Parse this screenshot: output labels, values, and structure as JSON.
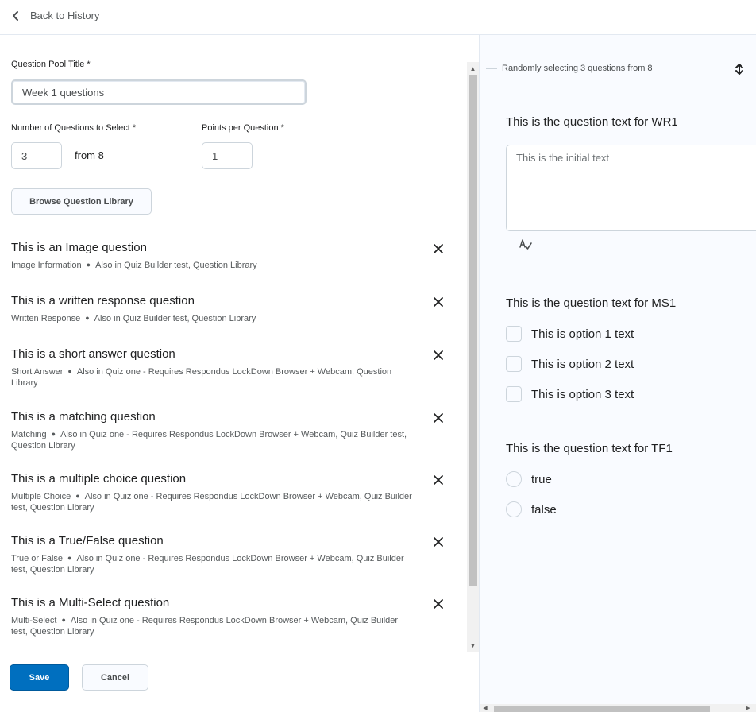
{
  "topbar": {
    "back_label": "Back to History"
  },
  "form": {
    "pool_title_label": "Question Pool Title *",
    "pool_title_value": "Week 1 questions",
    "num_questions_label": "Number of Questions to Select *",
    "num_questions_value": "3",
    "from_text": "from 8",
    "points_label": "Points per Question *",
    "points_value": "1",
    "browse_label": "Browse Question Library"
  },
  "questions": [
    {
      "title": "This is an Image question",
      "type": "Image Information",
      "also": "Also in Quiz Builder test, Question Library"
    },
    {
      "title": "This is a written response question",
      "type": "Written Response",
      "also": "Also in Quiz Builder test, Question Library"
    },
    {
      "title": "This is a short answer question",
      "type": "Short Answer",
      "also": "Also in Quiz one - Requires Respondus LockDown Browser + Webcam, Question Library"
    },
    {
      "title": "This is a matching question",
      "type": "Matching",
      "also": "Also in Quiz one - Requires Respondus LockDown Browser + Webcam, Quiz Builder test, Question Library"
    },
    {
      "title": "This is a multiple choice question",
      "type": "Multiple Choice",
      "also": "Also in Quiz one - Requires Respondus LockDown Browser + Webcam, Quiz Builder test, Question Library"
    },
    {
      "title": "This is a True/False question",
      "type": "True or False",
      "also": "Also in Quiz one - Requires Respondus LockDown Browser + Webcam, Quiz Builder test, Question Library"
    },
    {
      "title": "This is a Multi-Select question",
      "type": "Multi-Select",
      "also": "Also in Quiz one - Requires Respondus LockDown Browser + Webcam, Quiz Builder test, Question Library"
    }
  ],
  "actions": {
    "save_label": "Save",
    "cancel_label": "Cancel"
  },
  "preview": {
    "header": "Randomly selecting 3 questions from 8",
    "wr": {
      "title": "This is the question text for WR1",
      "initial_text": "This is the initial text"
    },
    "ms": {
      "title": "This is the question text for MS1",
      "options": [
        "This is option 1 text",
        "This is option 2 text",
        "This is option 3 text"
      ]
    },
    "tf": {
      "title": "This is the question text for TF1",
      "options": [
        "true",
        "false"
      ]
    }
  },
  "colors": {
    "primary": "#006fbf",
    "border": "#cdd5dc",
    "panel_bg": "#f9fbff"
  }
}
